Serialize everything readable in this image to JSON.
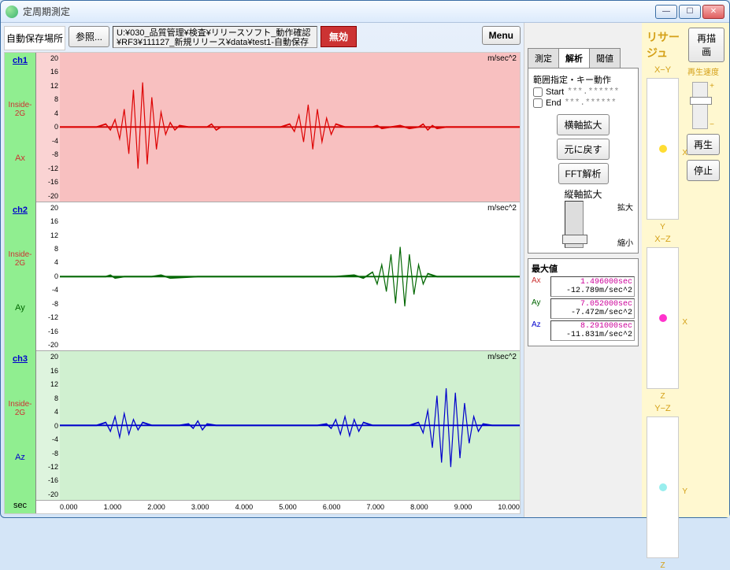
{
  "window": {
    "title": "定周期測定"
  },
  "toolbar": {
    "autosave_label": "自動保存場所",
    "browse_label": "参照...",
    "path": "U:¥030_品質管理¥検査¥リリースソフト_動作確認¥RF3¥111127_新規リリース¥data¥test1-自動保存",
    "invalid_label": "無効",
    "menu_label": "Menu"
  },
  "charts": {
    "sec_label": "sec",
    "xticks": [
      "0.000",
      "1.000",
      "2.000",
      "3.000",
      "4.000",
      "5.000",
      "6.000",
      "7.000",
      "8.000",
      "9.000",
      "10.000"
    ],
    "yticks": [
      "20",
      "16",
      "12",
      "8",
      "4",
      "0",
      "-4",
      "-8",
      "-12",
      "-16",
      "-20"
    ],
    "ch1": {
      "name": "ch1",
      "inside": "Inside-2G",
      "axis": "Ax",
      "unit": "m/sec^2"
    },
    "ch2": {
      "name": "ch2",
      "inside": "Inside-2G",
      "axis": "Ay",
      "unit": "m/sec^2"
    },
    "ch3": {
      "name": "ch3",
      "inside": "Inside-2G",
      "axis": "Az",
      "unit": "m/sec^2"
    }
  },
  "tabs": {
    "measure": "測定",
    "analyze": "解析",
    "threshold": "閾値"
  },
  "analyze": {
    "range_title": "範囲指定・キー動作",
    "start_label": "Start",
    "end_label": "End",
    "placeholder": "***.******",
    "hzoom": "横軸拡大",
    "reset": "元に戻す",
    "fft": "FFT解析",
    "vzoom_title": "縦軸拡大",
    "vzoom_in": "拡大",
    "vzoom_out": "縮小"
  },
  "max": {
    "title": "最大値",
    "ax": {
      "label": "Ax",
      "time": "1.496000sec",
      "val": "-12.789m/sec^2"
    },
    "ay": {
      "label": "Ay",
      "time": "7.052000sec",
      "val": "-7.472m/sec^2"
    },
    "az": {
      "label": "Az",
      "time": "8.291000sec",
      "val": "-11.831m/sec^2"
    }
  },
  "lissajous": {
    "title": "リサージュ",
    "redraw": "再描画",
    "speed_label": "再生速度",
    "plus": "+",
    "minus": "−",
    "play": "再生",
    "stop": "停止",
    "xy": {
      "title": "X−Y",
      "xlabel": "Y",
      "ylabel": "X",
      "color": "#ffdd33"
    },
    "xz": {
      "title": "X−Z",
      "xlabel": "Z",
      "ylabel": "X",
      "color": "#ff33cc"
    },
    "yz": {
      "title": "Y−Z",
      "xlabel": "Z",
      "ylabel": "Y",
      "color": "#99eeee"
    }
  },
  "chart_data": [
    {
      "type": "line",
      "name": "Ax",
      "title": "ch1",
      "xlabel": "sec",
      "ylabel": "m/sec^2",
      "xlim": [
        0,
        10
      ],
      "ylim": [
        -20,
        20
      ],
      "peak": {
        "time": 1.496,
        "value": -12.789
      }
    },
    {
      "type": "line",
      "name": "Ay",
      "title": "ch2",
      "xlabel": "sec",
      "ylabel": "m/sec^2",
      "xlim": [
        0,
        10
      ],
      "ylim": [
        -20,
        20
      ],
      "peak": {
        "time": 7.052,
        "value": -7.472
      }
    },
    {
      "type": "line",
      "name": "Az",
      "title": "ch3",
      "xlabel": "sec",
      "ylabel": "m/sec^2",
      "xlim": [
        0,
        10
      ],
      "ylim": [
        -20,
        20
      ],
      "peak": {
        "time": 8.291,
        "value": -11.831
      }
    }
  ]
}
